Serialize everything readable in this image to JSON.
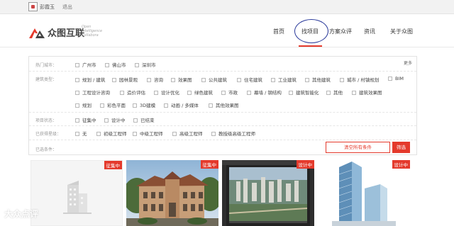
{
  "topbar": {
    "username": "彭霞玉",
    "logout": "退出"
  },
  "header": {
    "logo_text": "众图互联",
    "slogan": [
      "Open",
      "Intelligence",
      "Collabora"
    ],
    "nav": [
      "首页",
      "找项目",
      "方案众评",
      "资讯",
      "关于众图"
    ],
    "active_nav": "找项目",
    "accent_color": "#e43a2c",
    "highlight_ring_color": "#2a3a9a"
  },
  "filters": {
    "hot_cities": {
      "label": "热门城市：",
      "options": [
        "广州市",
        "佛山市",
        "深圳市"
      ],
      "more": "更多"
    },
    "building_type": {
      "label": "建筑类型：",
      "row1": [
        "规划 / 建筑",
        "园林景观",
        "咨询",
        "效果图",
        "公共建筑",
        "住宅建筑",
        "工业建筑",
        "其他建筑",
        "城市 / 村镇规划",
        "BIM"
      ],
      "row2": [
        "工程设计咨询",
        "造价评估",
        "设计优化",
        "绿色建筑",
        "市政",
        "幕墙 / 钢结构",
        "建筑智能化",
        "其他",
        "建筑效果图"
      ],
      "row3": [
        "规划",
        "彩色平面",
        "3D建模",
        "动画 / 多媒体",
        "其他效果图"
      ]
    },
    "project_status": {
      "label": "项目状态：",
      "options": [
        "征集中",
        "设计中",
        "已结束"
      ]
    },
    "engineer_level": {
      "label": "已获得星级：",
      "options": [
        "无",
        "初级工程师",
        "中级工程师",
        "高级工程师",
        "教授级高级工程师"
      ]
    },
    "selected": {
      "label": "已选条件："
    },
    "clear_button": "清空所有条件",
    "filter_button": "筛选"
  },
  "cards": [
    {
      "badge": "征集中",
      "image": "placeholder-building-icon"
    },
    {
      "badge": "征集中",
      "image": "villa-render"
    },
    {
      "badge": "设计中",
      "image": "city-aerial-render"
    },
    {
      "badge": "设计中",
      "image": "glass-tower-render"
    }
  ],
  "watermark": "大众点评"
}
